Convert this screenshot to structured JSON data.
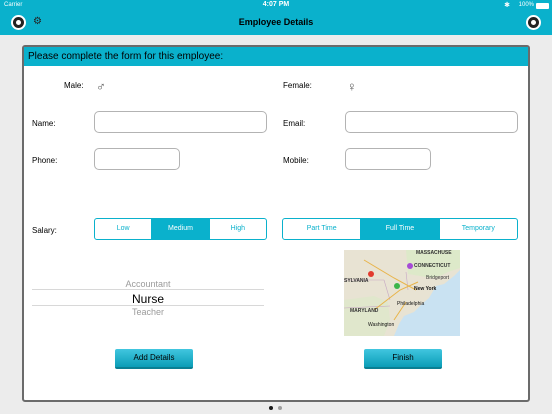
{
  "status_bar": {
    "carrier": "Carrier",
    "time": "4:07 PM",
    "battery": "100%"
  },
  "nav": {
    "title": "Employee Details"
  },
  "form": {
    "header": "Please complete the form for this employee:",
    "male_label": "Male:",
    "female_label": "Female:",
    "male_symbol": "♂",
    "female_symbol": "♀",
    "name_label": "Name:",
    "name_value": "",
    "email_label": "Email:",
    "email_value": "",
    "phone_label": "Phone:",
    "phone_value": "",
    "mobile_label": "Mobile:",
    "mobile_value": "",
    "salary_label": "Salary:",
    "salary_options": [
      "Low",
      "Medium",
      "High"
    ],
    "salary_selected": "Medium",
    "employment_options": [
      "Part Time",
      "Full Time",
      "Temporary"
    ],
    "employment_selected": "Full Time",
    "role_picker": [
      "Accountant",
      "Nurse",
      "Teacher"
    ],
    "role_selected": "Nurse",
    "map_labels": [
      "MASSACHUSE",
      "CONNECTICUT",
      "Bridgeport",
      "SYLVANIA",
      "New York",
      "Philadelphia",
      "MARYLAND",
      "Washington"
    ],
    "add_button": "Add Details",
    "finish_button": "Finish"
  },
  "page_indicator": {
    "count": 2,
    "current": 1
  },
  "colors": {
    "accent": "#0ab1cc",
    "pin_red": "#e23a2e",
    "pin_purple": "#a64bd6",
    "pin_green": "#3bb54a"
  }
}
